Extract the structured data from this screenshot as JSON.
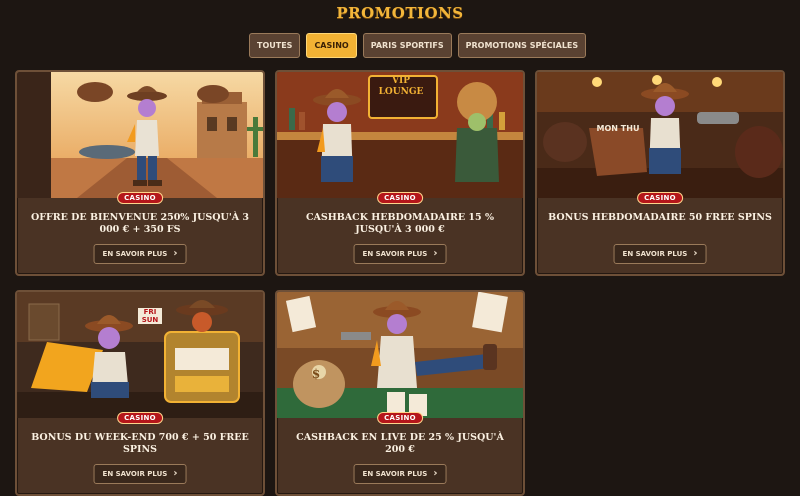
{
  "page": {
    "title": "PROMOTIONS"
  },
  "tabs": [
    {
      "label": "TOUTES",
      "active": false
    },
    {
      "label": "CASINO",
      "active": true
    },
    {
      "label": "PARIS SPORTIFS",
      "active": false
    },
    {
      "label": "PROMOTIONS SPÉCIALES",
      "active": false
    }
  ],
  "cards": [
    {
      "badge": "CASINO",
      "title": "OFFRE DE BIENVENUE 250% JUSQU'À 3 000 € + 350 FS",
      "cta": "EN SAVOIR PLUS",
      "scene": "desert-street"
    },
    {
      "badge": "CASINO",
      "title": "CASHBACK HEBDOMADAIRE 15 % JUSQU'À 3 000 €",
      "cta": "EN SAVOIR PLUS",
      "scene": "vip-lounge",
      "sign_text": "VIP LOUNGE"
    },
    {
      "badge": "CASINO",
      "title": "BONUS HEBDOMADAIRE 50 FREE SPINS",
      "cta": "EN SAVOIR PLUS",
      "scene": "saloon-bag",
      "bag_text": "MON THU"
    },
    {
      "badge": "CASINO",
      "title": "BONUS DU WEEK-END 700 € + 50 FREE SPINS",
      "cta": "EN SAVOIR PLUS",
      "scene": "slot-machine",
      "sign_text": "FRI SUN"
    },
    {
      "badge": "CASINO",
      "title": "CASHBACK EN LIVE DE 25 % JUSQU'À 200 €",
      "cta": "EN SAVOIR PLUS",
      "scene": "card-table",
      "bag_text": "$"
    }
  ],
  "icons": {
    "cta_arrow": "chevron-right-icon"
  },
  "colors": {
    "accent": "#f2b234",
    "badge": "#b5161a",
    "card_bg": "#4a3324",
    "page_bg": "#1d1612"
  }
}
